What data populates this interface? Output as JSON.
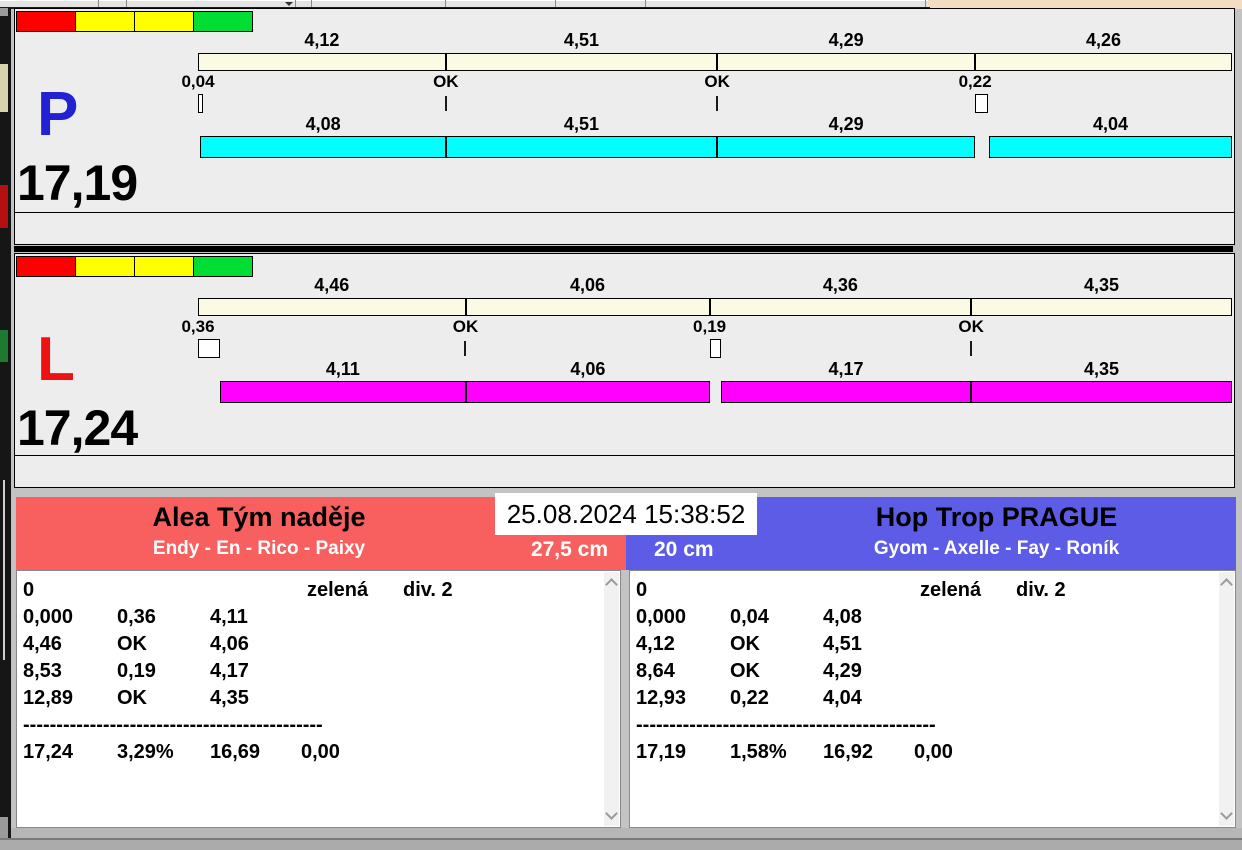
{
  "clock": "25.08.2024 15:38:52",
  "colors": {
    "panel_bg": "#ededed",
    "ref_bar": "#fbfbe4",
    "lane_p_bar": "#00ffff",
    "lane_l_bar": "#ff00ff",
    "lane_p_letter": "#2222d2",
    "lane_l_letter": "#ee1111",
    "team_left_bg": "#f86060",
    "team_right_bg": "#5c5ce6",
    "start_lights": [
      "#ff0000",
      "#ffff00",
      "#ffff00",
      "#00dd33"
    ]
  },
  "lanes": [
    {
      "letter": "P",
      "letter_color": "#2222d2",
      "total_label": "17,19",
      "total": 17.19,
      "bar_color": "#00ffff",
      "ref_labels": [
        "4,12",
        "4,51",
        "4,29",
        "4,26"
      ],
      "ref_bounds": [
        0,
        4.12,
        8.63,
        12.92,
        17.19
      ],
      "marks": [
        {
          "label": "0,04",
          "time": 0,
          "fault": 0.04
        },
        {
          "label": "OK",
          "time": 4.12,
          "fault": 0
        },
        {
          "label": "OK",
          "time": 8.63,
          "fault": 0
        },
        {
          "label": "0,22",
          "time": 12.92,
          "fault": 0.22
        }
      ],
      "dog_labels": [
        "4,08",
        "4,51",
        "4,29",
        "4,04"
      ],
      "dog_segments": [
        [
          0.04,
          4.12
        ],
        [
          4.12,
          8.63
        ],
        [
          8.63,
          12.92
        ],
        [
          13.15,
          17.19
        ]
      ]
    },
    {
      "letter": "L",
      "letter_color": "#ee1111",
      "total_label": "17,24",
      "total": 17.24,
      "bar_color": "#ff00ff",
      "ref_labels": [
        "4,46",
        "4,06",
        "4,36",
        "4,35"
      ],
      "ref_bounds": [
        0,
        4.46,
        8.53,
        12.89,
        17.24
      ],
      "marks": [
        {
          "label": "0,36",
          "time": 0,
          "fault": 0.36
        },
        {
          "label": "OK",
          "time": 4.46,
          "fault": 0
        },
        {
          "label": "0,19",
          "time": 8.53,
          "fault": 0.19
        },
        {
          "label": "OK",
          "time": 12.89,
          "fault": 0
        }
      ],
      "dog_labels": [
        "4,11",
        "4,06",
        "4,17",
        "4,35"
      ],
      "dog_segments": [
        [
          0.36,
          4.47
        ],
        [
          4.47,
          8.53
        ],
        [
          8.72,
          12.89
        ],
        [
          12.89,
          17.24
        ]
      ]
    }
  ],
  "teams": [
    {
      "name": "Alea Tým naděje",
      "lineup": "Endy - En - Rico - Paixy",
      "jump_height": "27,5 cm",
      "bg_color": "#f86060",
      "results": {
        "run_no": "0",
        "lane_color": "zelená",
        "division": "div. 2",
        "rows": [
          [
            "0,000",
            "0,36",
            "4,11"
          ],
          [
            "4,46",
            "OK",
            "4,06"
          ],
          [
            "8,53",
            "0,19",
            "4,17"
          ],
          [
            "12,89",
            "OK",
            "4,35"
          ]
        ],
        "dashes": "---------------------------------------------",
        "totals": [
          "17,24",
          "3,29%",
          "16,69",
          "0,00"
        ]
      }
    },
    {
      "name": "Hop Trop PRAGUE",
      "lineup": "Gyom - Axelle - Fay - Roník",
      "jump_height": "20 cm",
      "bg_color": "#5c5ce6",
      "results": {
        "run_no": "0",
        "lane_color": "zelená",
        "division": "div. 2",
        "rows": [
          [
            "0,000",
            "0,04",
            "4,08"
          ],
          [
            "4,12",
            "OK",
            "4,51"
          ],
          [
            "8,64",
            "OK",
            "4,29"
          ],
          [
            "12,93",
            "0,22",
            "4,04"
          ]
        ],
        "dashes": "---------------------------------------------",
        "totals": [
          "17,19",
          "1,58%",
          "16,92",
          "0,00"
        ]
      }
    }
  ]
}
